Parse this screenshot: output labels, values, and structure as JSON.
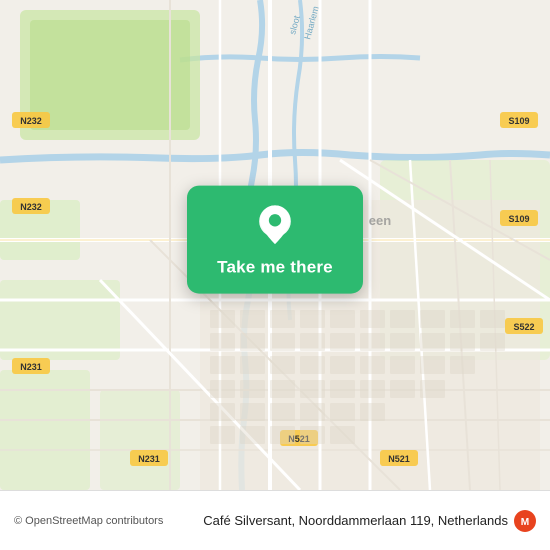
{
  "map": {
    "background_color": "#f2efe9",
    "alt": "Map of Café Silversant area, Netherlands"
  },
  "card": {
    "label": "Take me there",
    "background_color": "#2dba70"
  },
  "bottom_bar": {
    "copyright": "© OpenStreetMap contributors",
    "address": "Café Silversant, Noorddammerlaan 119, Netherlands",
    "logo_text": "moovit"
  }
}
